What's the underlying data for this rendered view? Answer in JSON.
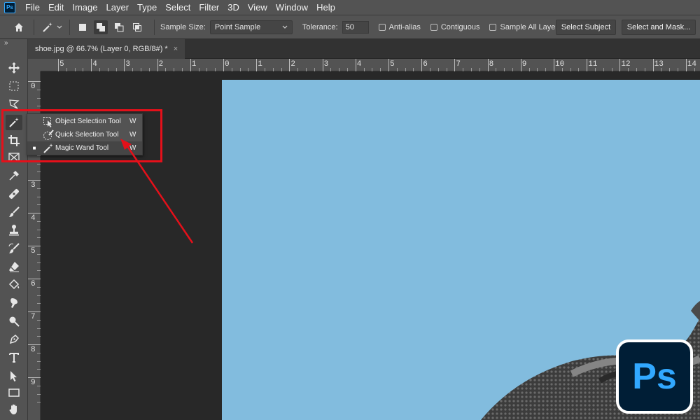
{
  "app": {
    "icon_text": "Ps"
  },
  "menu": [
    "File",
    "Edit",
    "Image",
    "Layer",
    "Type",
    "Select",
    "Filter",
    "3D",
    "View",
    "Window",
    "Help"
  ],
  "options": {
    "sample_size_label": "Sample Size:",
    "sample_size_value": "Point Sample",
    "tolerance_label": "Tolerance:",
    "tolerance_value": "50",
    "anti_alias": "Anti-alias",
    "contiguous": "Contiguous",
    "sample_all_layers": "Sample All Layers",
    "select_subject": "Select Subject",
    "select_and_mask": "Select and Mask..."
  },
  "tab": {
    "title": "shoe.jpg @ 66.7% (Layer 0, RGB/8#) *",
    "close": "×"
  },
  "toolbar": {
    "collapse": "»"
  },
  "ruler": {
    "h": [
      "5",
      "4",
      "3",
      "2",
      "1",
      "0",
      "1",
      "2",
      "3",
      "4",
      "5",
      "6",
      "7",
      "8",
      "9",
      "10",
      "11",
      "12",
      "13",
      "14"
    ],
    "v": [
      "0",
      "1",
      "2",
      "3",
      "4",
      "5",
      "6",
      "7",
      "8",
      "9"
    ]
  },
  "flyout": {
    "items": [
      {
        "label": "Object Selection Tool",
        "shortcut": "W",
        "selected": false
      },
      {
        "label": "Quick Selection Tool",
        "shortcut": "W",
        "selected": false
      },
      {
        "label": "Magic Wand Tool",
        "shortcut": "W",
        "selected": true
      }
    ]
  },
  "colors": {
    "canvas": "#82bcde",
    "highlight": "#e5101a",
    "ps_blue": "#31a8ff",
    "ps_bg": "#001e36"
  },
  "logo": {
    "text": "Ps"
  }
}
